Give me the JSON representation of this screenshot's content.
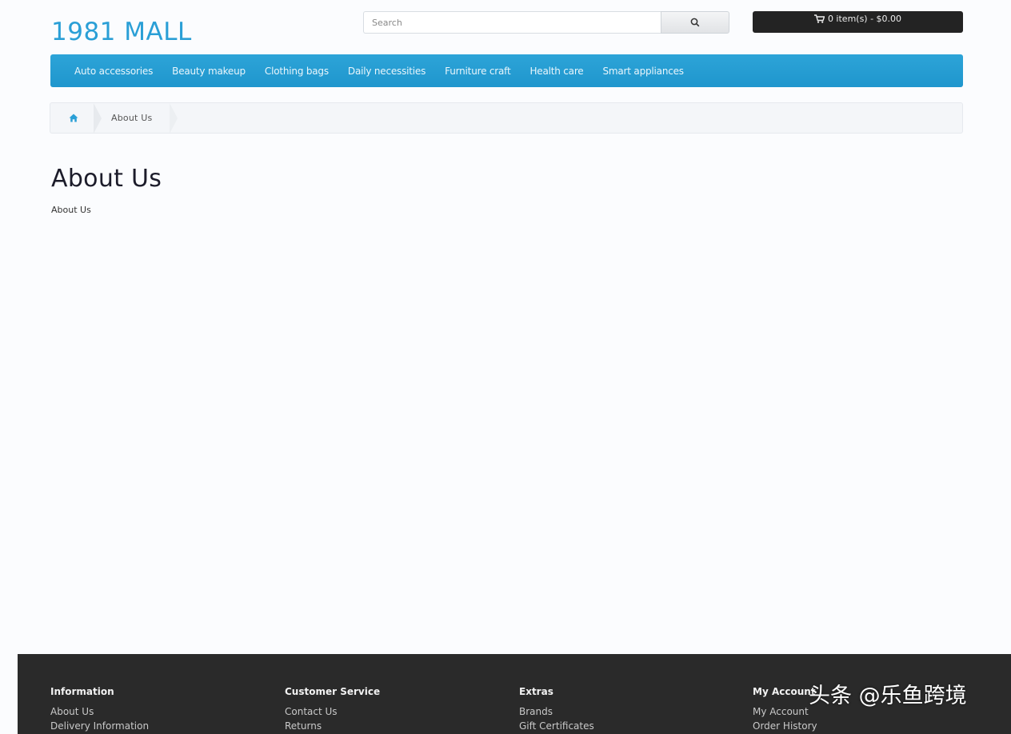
{
  "header": {
    "logo": "1981 MALL",
    "search_placeholder": "Search",
    "cart_label": "0 item(s) - $0.00"
  },
  "menu": {
    "items": [
      "Auto accessories",
      "Beauty makeup",
      "Clothing bags",
      "Daily necessities",
      "Furniture craft",
      "Health care",
      "Smart appliances"
    ]
  },
  "breadcrumb": {
    "current": "About Us"
  },
  "content": {
    "title": "About Us",
    "body": "About Us"
  },
  "footer": {
    "columns": [
      {
        "heading": "Information",
        "links": [
          "About Us",
          "Delivery Information"
        ]
      },
      {
        "heading": "Customer Service",
        "links": [
          "Contact Us",
          "Returns"
        ]
      },
      {
        "heading": "Extras",
        "links": [
          "Brands",
          "Gift Certificates"
        ]
      },
      {
        "heading": "My Account",
        "links": [
          "My Account",
          "Order History"
        ]
      }
    ]
  },
  "watermark": {
    "text": "头条 @乐鱼跨境"
  },
  "colors": {
    "brand": "#2a9fd6",
    "menu_bg": "#1f96cd",
    "cart_bg": "#232323",
    "footer_bg": "#2a2a2a"
  }
}
